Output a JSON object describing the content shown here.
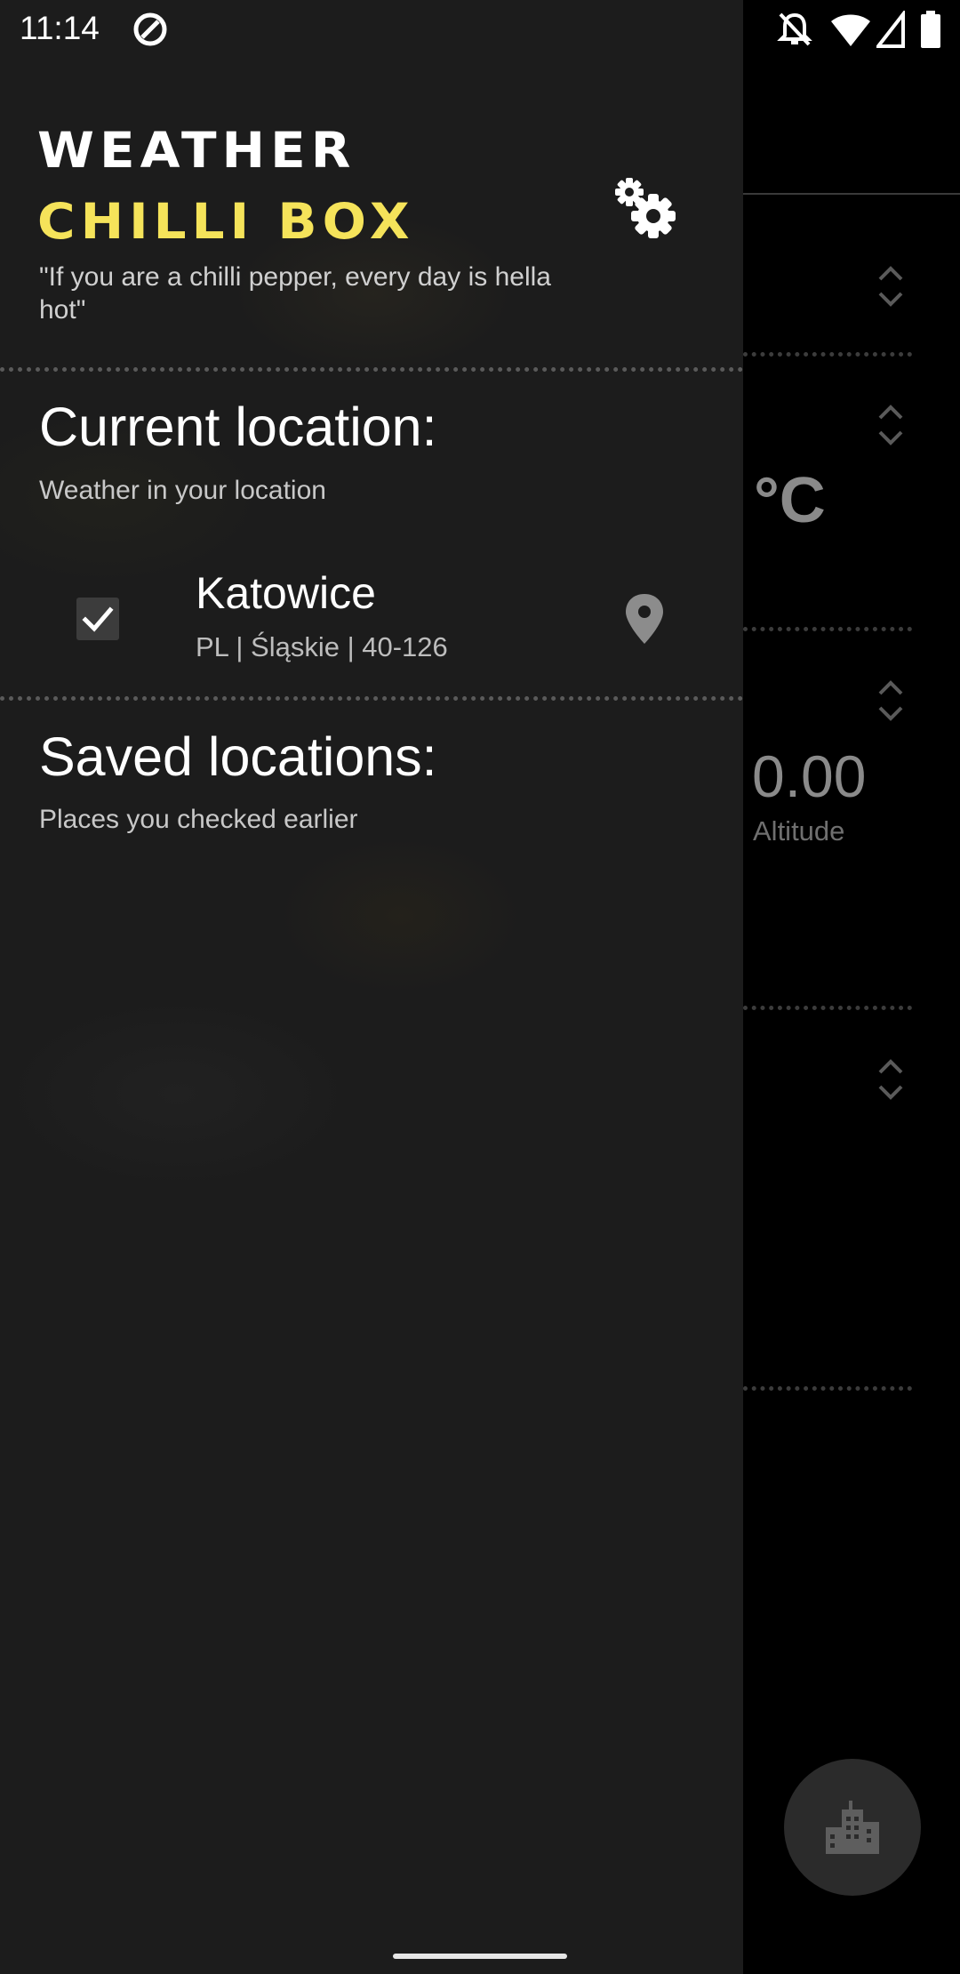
{
  "status_bar": {
    "time": "11:14",
    "icons": [
      "at-sign-icon",
      "bell-off-icon",
      "wifi-icon",
      "signal-icon",
      "battery-icon"
    ]
  },
  "background_screen": {
    "temperature_unit": "°C",
    "altitude_value": "0.00",
    "altitude_label": "Altitude",
    "fab_icon": "city-buildings-icon"
  },
  "drawer": {
    "title_line1": "WEATHER",
    "title_line2": "CHILLI BOX",
    "tagline": "\"If you are a chilli pepper, every day is hella hot\"",
    "settings_icon": "gears-icon",
    "current_location": {
      "title": "Current location:",
      "subtitle": "Weather in your location",
      "item": {
        "checked": true,
        "city": "Katowice",
        "details": "PL | Śląskie | 40-126",
        "icon": "map-pin-icon"
      }
    },
    "saved_locations": {
      "title": "Saved locations:",
      "subtitle": "Places you checked earlier"
    }
  },
  "colors": {
    "drawer_bg": "#1c1c1c",
    "accent_yellow": "#f5e35a",
    "screen_bg": "#000000"
  }
}
